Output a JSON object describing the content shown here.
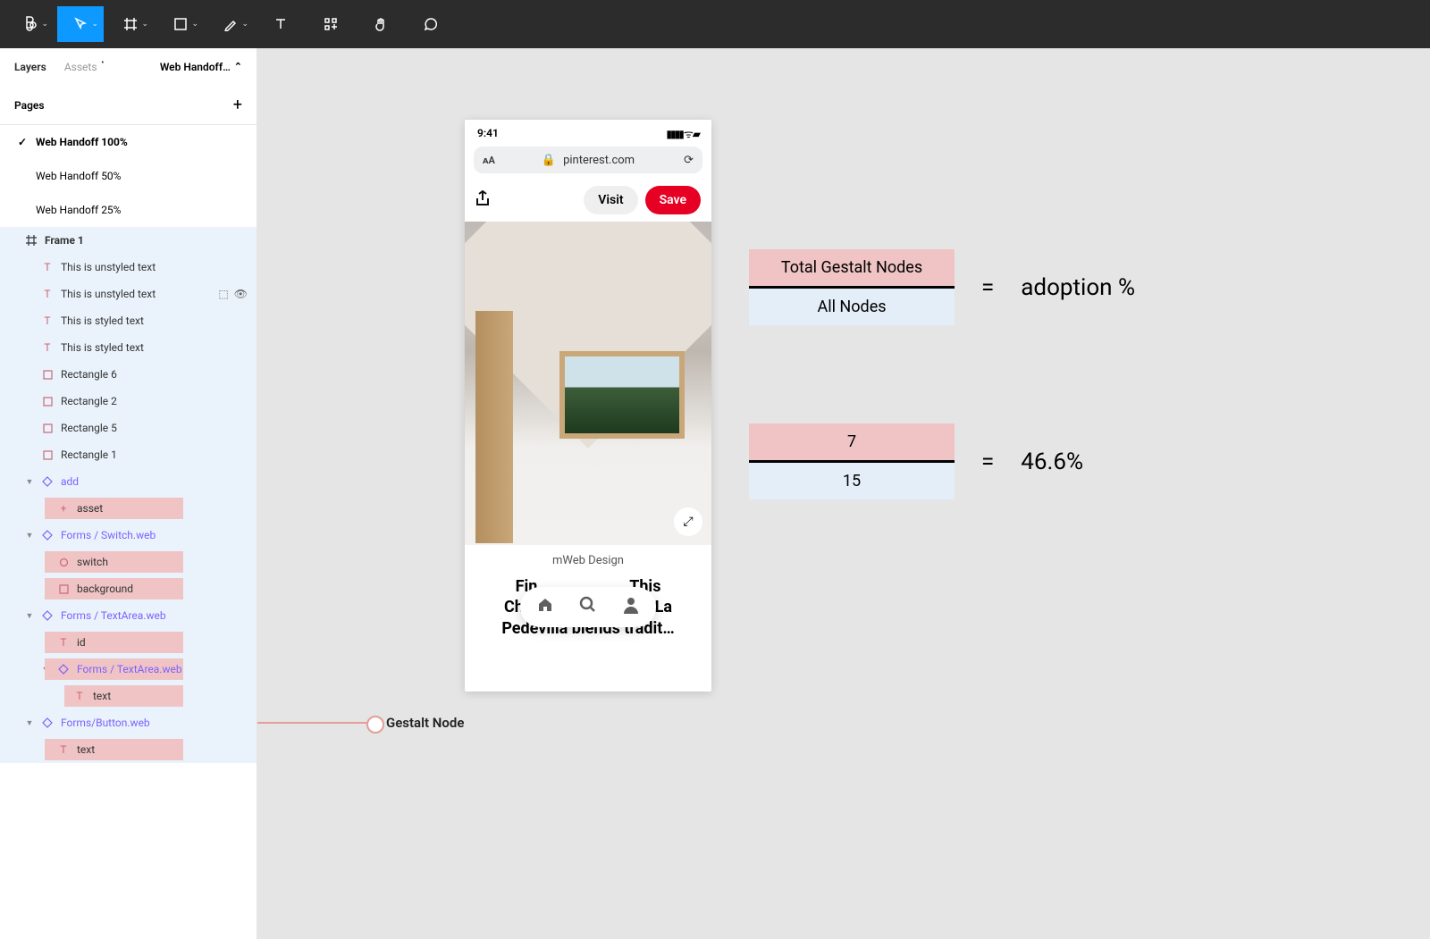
{
  "toolbar": {
    "tools": [
      "figma",
      "move",
      "frame",
      "rectangle",
      "pen",
      "text",
      "resources",
      "hand",
      "comment"
    ]
  },
  "side": {
    "tabs": {
      "layers": "Layers",
      "assets": "Assets"
    },
    "file": "Web Handoff…",
    "pagesTitle": "Pages",
    "pages": [
      {
        "label": "Web Handoff 100%",
        "active": true
      },
      {
        "label": "Web Handoff 50%",
        "active": false
      },
      {
        "label": "Web Handoff 25%",
        "active": false
      }
    ],
    "layers": [
      {
        "txt": "Frame 1",
        "indent": 0,
        "kind": "frame",
        "bold": true
      },
      {
        "txt": "This is unstyled text",
        "indent": 1,
        "kind": "text"
      },
      {
        "txt": "This is unstyled text",
        "indent": 1,
        "kind": "text",
        "actions": true
      },
      {
        "txt": "This is styled text",
        "indent": 1,
        "kind": "text"
      },
      {
        "txt": "This is styled text",
        "indent": 1,
        "kind": "text"
      },
      {
        "txt": "Rectangle 6",
        "indent": 1,
        "kind": "rect"
      },
      {
        "txt": "Rectangle 2",
        "indent": 1,
        "kind": "rect"
      },
      {
        "txt": "Rectangle 5",
        "indent": 1,
        "kind": "rect"
      },
      {
        "txt": "Rectangle 1",
        "indent": 1,
        "kind": "rect"
      },
      {
        "txt": "add",
        "indent": 1,
        "kind": "comp",
        "caret": true
      },
      {
        "txt": "asset",
        "indent": 2,
        "kind": "pink",
        "icon": "plus"
      },
      {
        "txt": "Forms / Switch.web",
        "indent": 1,
        "kind": "comp",
        "caret": true
      },
      {
        "txt": "switch",
        "indent": 2,
        "kind": "pink",
        "icon": "circle"
      },
      {
        "txt": "background",
        "indent": 2,
        "kind": "pink",
        "icon": "rect"
      },
      {
        "txt": "Forms / TextArea.web",
        "indent": 1,
        "kind": "comp",
        "caret": true
      },
      {
        "txt": "id",
        "indent": 2,
        "kind": "pink",
        "icon": "text"
      },
      {
        "txt": "Forms / TextArea.web",
        "indent": 2,
        "kind": "comp-pink",
        "caret": true
      },
      {
        "txt": "text",
        "indent": 3,
        "kind": "pink",
        "icon": "text"
      },
      {
        "txt": "Forms/Button.web",
        "indent": 1,
        "kind": "comp",
        "caret": true
      },
      {
        "txt": "text",
        "indent": 2,
        "kind": "pink",
        "icon": "text"
      }
    ]
  },
  "phone": {
    "time": "9:41",
    "url": "pinterest.com",
    "visit": "Visit",
    "save": "Save",
    "site": "mWeb Design",
    "title_a": "Fin",
    "title_b": "his",
    "title_c": "Chalet",
    "title_d": "ips. La",
    "title_e": "Pedevilla blends tradit…"
  },
  "formulas": {
    "f1": {
      "num": "Total Gestalt Nodes",
      "den": "All Nodes",
      "res": "adoption %"
    },
    "f2": {
      "num": "7",
      "den": "15",
      "res": "46.6%"
    }
  },
  "callout": "Gestalt Node"
}
